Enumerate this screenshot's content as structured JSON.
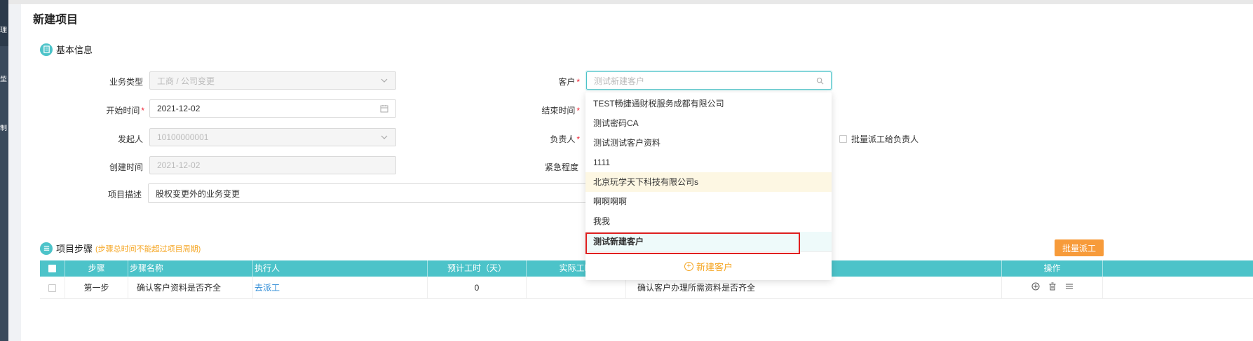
{
  "sidebar": {
    "glyphs": [
      "理",
      "型",
      "制"
    ]
  },
  "page": {
    "title": "新建项目"
  },
  "basic": {
    "section_title": "基本信息",
    "business_type": {
      "label": "业务类型",
      "value": "工商 / 公司变更"
    },
    "start_time": {
      "label": "开始时间",
      "req": "*",
      "value": "2021-12-02"
    },
    "initiator": {
      "label": "发起人",
      "value": "10100000001"
    },
    "created_time": {
      "label": "创建时间",
      "value": "2021-12-02"
    },
    "description": {
      "label": "项目描述",
      "value": "股权变更外的业务变更"
    },
    "customer": {
      "label": "客户",
      "req": "*",
      "placeholder": "测试新建客户"
    },
    "end_time": {
      "label": "结束时间",
      "req": "*"
    },
    "owner": {
      "label": "负责人",
      "req": "*"
    },
    "urgency": {
      "label": "紧急程度"
    },
    "batch_assign_owner": "批量派工给负责人"
  },
  "customer_dropdown": {
    "items": [
      "TEST畅捷通财税服务成都有限公司",
      "测试密码CA",
      "测试测试客户资料",
      "1111",
      "北京玩学天下科技有限公司s",
      "啊啊啊啊",
      "我我",
      "测试新建客户"
    ],
    "hovered_index": 4,
    "selected_index": 7,
    "new_customer_label": "新建客户"
  },
  "steps": {
    "section_title": "项目步骤",
    "note": "(步骤总时间不能超过项目周期)",
    "batch_button": "批量派工",
    "columns": [
      "步骤",
      "步骤名称",
      "执行人",
      "预计工时（天）",
      "实际工时",
      "操作"
    ],
    "rows": [
      {
        "step": "第一步",
        "name": "确认客户资料是否齐全",
        "executor": "去派工",
        "estimated": "0",
        "actual": "",
        "remark": "确认客户办理所需资料是否齐全"
      }
    ]
  },
  "colors": {
    "accent": "#4cc3c9",
    "orange": "#f79b3a",
    "highlight": "#e02020"
  }
}
